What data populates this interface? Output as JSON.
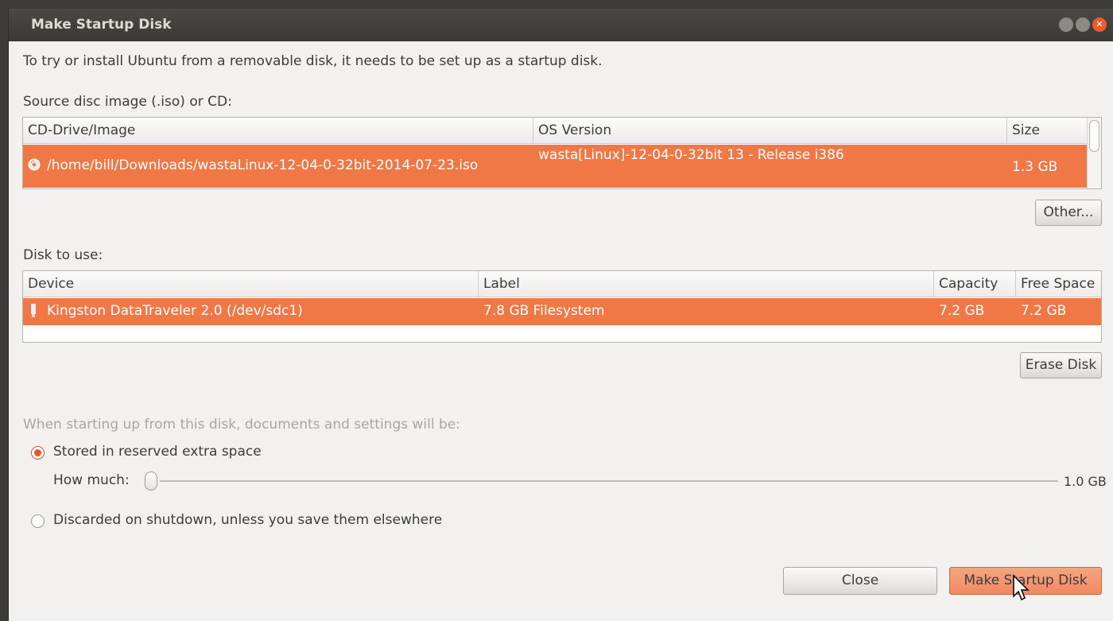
{
  "window": {
    "title": "Make Startup Disk"
  },
  "intro_text": "To try or install Ubuntu from a removable disk, it needs to be set up as a startup disk.",
  "source": {
    "label": "Source disc image (.iso) or CD:",
    "columns": [
      "CD-Drive/Image",
      "OS Version",
      "Size"
    ],
    "rows": [
      {
        "icon": "disc-icon",
        "image": "/home/bill/Downloads/wastaLinux-12-04-0-32bit-2014-07-23.iso",
        "os_version": "wasta[Linux]-12-04-0-32bit 13 - Release i386",
        "size": "1.3 GB",
        "selected": true
      }
    ],
    "other_button": "Other..."
  },
  "disk": {
    "label": "Disk to use:",
    "columns": [
      "Device",
      "Label",
      "Capacity",
      "Free Space"
    ],
    "rows": [
      {
        "icon": "usb-drive-icon",
        "device": "Kingston DataTraveler 2.0 (/dev/sdc1)",
        "label": "7.8 GB Filesystem",
        "capacity": "7.2 GB",
        "free_space": "7.2 GB",
        "selected": true
      }
    ],
    "erase_button": "Erase Disk"
  },
  "persistence": {
    "heading": "When starting up from this disk, documents and settings will be:",
    "option_stored": "Stored in reserved extra space",
    "how_much_label": "How much:",
    "slider_value": "1.0 GB",
    "slider_fraction": 0.0,
    "option_discarded": "Discarded on shutdown, unless you save them elsewhere",
    "selected_option": "stored"
  },
  "buttons": {
    "close": "Close",
    "make": "Make Startup Disk"
  },
  "colors": {
    "accent": "#f07746",
    "titlebar": "#3c3b37",
    "window_bg": "#f2f1f0"
  }
}
